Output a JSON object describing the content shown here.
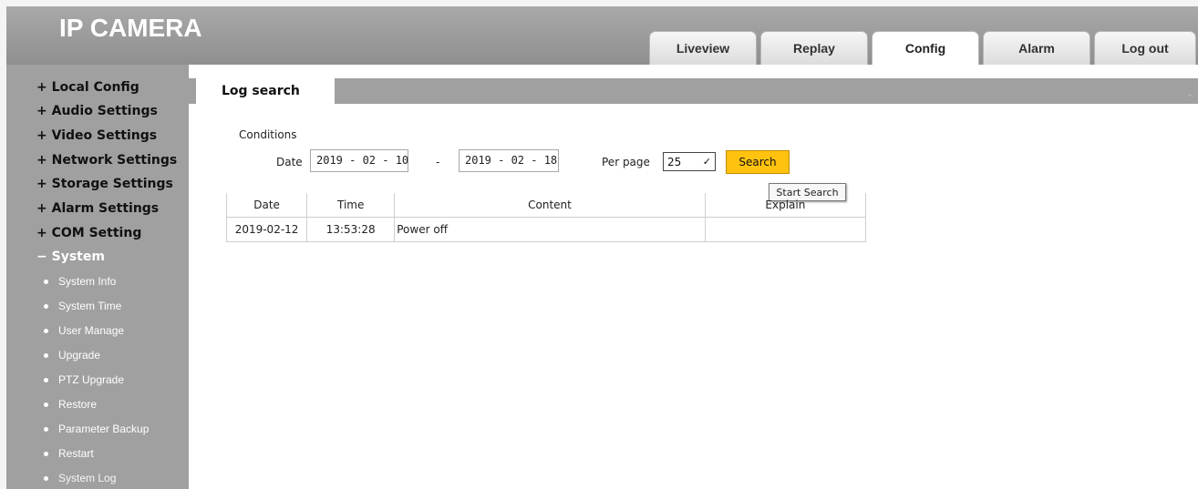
{
  "app": {
    "title": "IP CAMERA"
  },
  "nav": {
    "tabs": [
      {
        "label": "Liveview"
      },
      {
        "label": "Replay"
      },
      {
        "label": "Config"
      },
      {
        "label": "Alarm"
      },
      {
        "label": "Log out"
      }
    ],
    "active_tab": "Config"
  },
  "sidebar": {
    "items": [
      {
        "label": "+ Local Config"
      },
      {
        "label": "+ Audio Settings"
      },
      {
        "label": "+ Video Settings"
      },
      {
        "label": "+ Network Settings"
      },
      {
        "label": "+ Storage Settings"
      },
      {
        "label": "+ Alarm Settings"
      },
      {
        "label": "+ COM Setting"
      },
      {
        "label": "− System"
      }
    ],
    "sub_items": [
      {
        "label": "System Info"
      },
      {
        "label": "System Time"
      },
      {
        "label": "User Manage"
      },
      {
        "label": "Upgrade"
      },
      {
        "label": "PTZ Upgrade"
      },
      {
        "label": "Restore"
      },
      {
        "label": "Parameter Backup"
      },
      {
        "label": "Restart"
      },
      {
        "label": "System Log"
      }
    ],
    "current_sub_item": "System Log"
  },
  "page": {
    "tab_label": "Log search",
    "conditions_label": "Conditions",
    "date_label": "Date",
    "date_from": "2019 - 02 - 10",
    "date_separator": "-",
    "date_to": "2019 - 02 - 18",
    "per_page_label": "Per page",
    "per_page_value": "25",
    "search_label": "Search",
    "tooltip": "Start Search"
  },
  "table": {
    "headers": [
      "Date",
      "Time",
      "Content",
      "Explain"
    ],
    "rows": [
      [
        "2019-02-12",
        "13:53:28",
        "Power off",
        ""
      ]
    ]
  },
  "colors": {
    "header_bg": "#9a9a9a",
    "sidebar_bg": "#a0a0a0",
    "search_button": "#ffc20e"
  }
}
